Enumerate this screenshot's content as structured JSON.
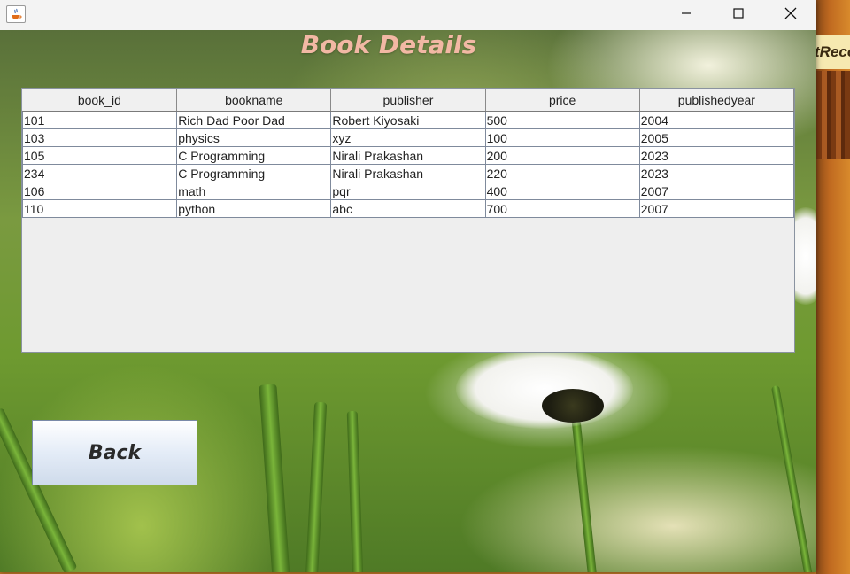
{
  "background_app": {
    "title_fragment": "tReco"
  },
  "titlebar": {
    "icons": [
      "java-app-icon",
      "minimize-icon",
      "maximize-icon",
      "close-icon"
    ]
  },
  "page": {
    "title": "Book Details"
  },
  "table": {
    "columns": [
      "book_id",
      "bookname",
      "publisher",
      "price",
      "publishedyear"
    ],
    "rows": [
      [
        "101",
        "Rich Dad Poor Dad",
        "Robert Kiyosaki",
        "500",
        "2004"
      ],
      [
        "103",
        "physics",
        "xyz",
        "100",
        "2005"
      ],
      [
        "105",
        "C Programming",
        "Nirali Prakashan",
        "200",
        "2023"
      ],
      [
        "234",
        "C Programming",
        "Nirali Prakashan",
        "220",
        "2023"
      ],
      [
        "106",
        "math",
        "pqr",
        "400",
        "2007"
      ],
      [
        "110",
        "python",
        "abc",
        "700",
        "2007"
      ]
    ]
  },
  "actions": {
    "back_label": "Back"
  },
  "colors": {
    "title": "#f2b8a4",
    "table_background": "#eeeeee",
    "button_gradient_top": "#ffffff",
    "button_gradient_bottom": "#cfdbeb"
  }
}
